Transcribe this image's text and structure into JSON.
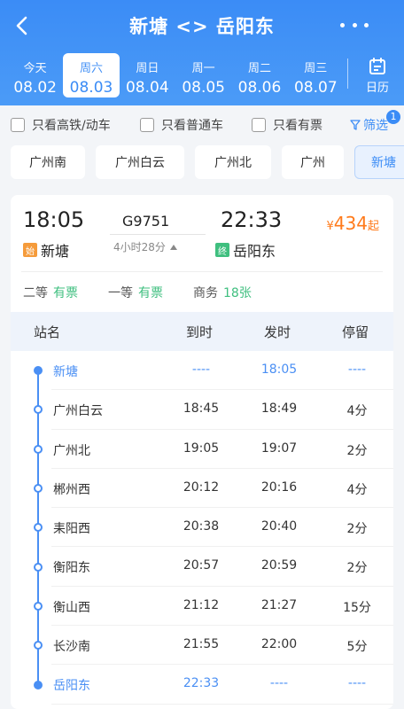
{
  "header": {
    "title": "新塘 <> 岳阳东",
    "colors": {
      "accent": "#3b8cf6",
      "header_bg": "#4b9bf7"
    },
    "dates": [
      {
        "weekday": "今天",
        "date": "08.02",
        "selected": false
      },
      {
        "weekday": "周六",
        "date": "08.03",
        "selected": true
      },
      {
        "weekday": "周日",
        "date": "08.04",
        "selected": false
      },
      {
        "weekday": "周一",
        "date": "08.05",
        "selected": false
      },
      {
        "weekday": "周二",
        "date": "08.06",
        "selected": false
      },
      {
        "weekday": "周三",
        "date": "08.07",
        "selected": false
      }
    ],
    "calendar_label": "日历"
  },
  "filters": {
    "options": [
      "只看高铁/动车",
      "只看普通车",
      "只看有票"
    ],
    "screen_label": "筛选",
    "screen_badge": "1"
  },
  "stations": [
    "广州南",
    "广州白云",
    "广州北",
    "广州",
    "新塘"
  ],
  "train": {
    "number": "G9751",
    "depart_time": "18:05",
    "arrive_time": "22:33",
    "duration": "4小时28分",
    "from_station": "新塘",
    "to_station": "岳阳东",
    "start_tag": "始",
    "end_tag": "终",
    "price_symbol": "¥",
    "price": "434",
    "price_suffix": "起",
    "price_color": "#ff7a1a",
    "seats": [
      {
        "class": "二等",
        "status": "有票"
      },
      {
        "class": "一等",
        "status": "有票"
      },
      {
        "class": "商务",
        "status": "18张"
      }
    ]
  },
  "table": {
    "headers": {
      "name": "站名",
      "arrive": "到时",
      "depart": "发时",
      "stop": "停留"
    },
    "rows": [
      {
        "name": "新塘",
        "arrive": "----",
        "depart": "18:05",
        "stop": "----",
        "highlight": true
      },
      {
        "name": "广州白云",
        "arrive": "18:45",
        "depart": "18:49",
        "stop": "4分",
        "highlight": false
      },
      {
        "name": "广州北",
        "arrive": "19:05",
        "depart": "19:07",
        "stop": "2分",
        "highlight": false
      },
      {
        "name": "郴州西",
        "arrive": "20:12",
        "depart": "20:16",
        "stop": "4分",
        "highlight": false
      },
      {
        "name": "耒阳西",
        "arrive": "20:38",
        "depart": "20:40",
        "stop": "2分",
        "highlight": false
      },
      {
        "name": "衡阳东",
        "arrive": "20:57",
        "depart": "20:59",
        "stop": "2分",
        "highlight": false
      },
      {
        "name": "衡山西",
        "arrive": "21:12",
        "depart": "21:27",
        "stop": "15分",
        "highlight": false
      },
      {
        "name": "长沙南",
        "arrive": "21:55",
        "depart": "22:00",
        "stop": "5分",
        "highlight": false
      },
      {
        "name": "岳阳东",
        "arrive": "22:33",
        "depart": "----",
        "stop": "----",
        "highlight": true
      }
    ],
    "track_color": "#4a8ff4"
  }
}
